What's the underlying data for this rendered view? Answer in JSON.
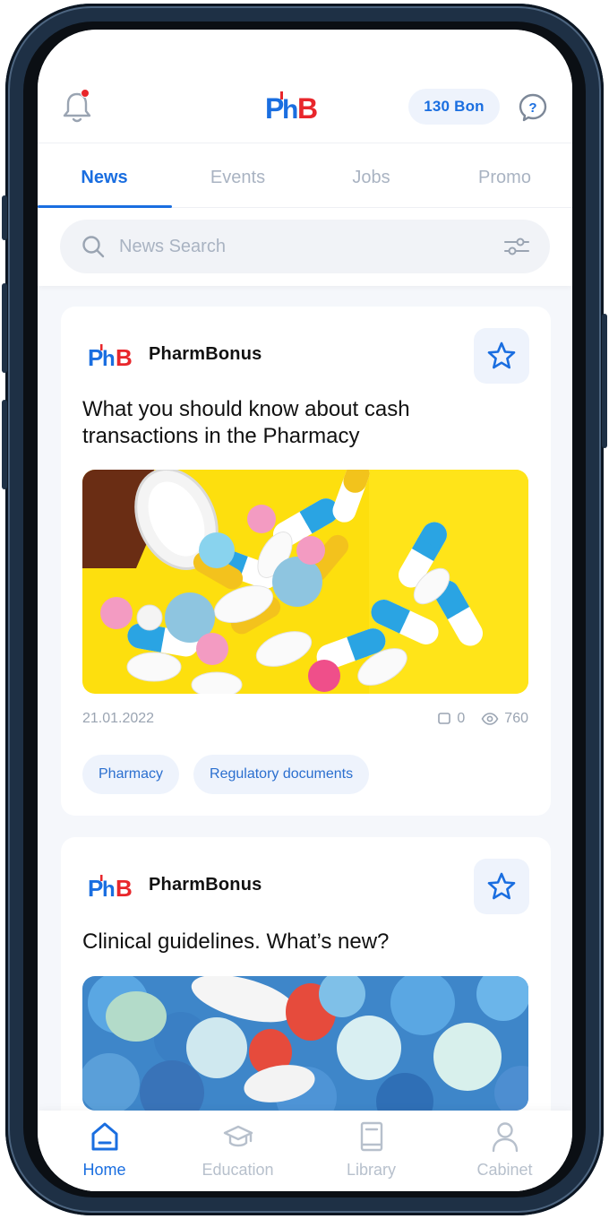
{
  "colors": {
    "accent": "#1a6ee0",
    "accent_bg": "#eef3fc",
    "notification_dot": "#e8262b",
    "inactive": "#a9b3c2",
    "logo_red": "#e8262b",
    "logo_blue": "#1a6ee0"
  },
  "header": {
    "logo_text": "PhB",
    "bonus_label": "130 Bon",
    "icons": {
      "left": "bell-icon",
      "right": "help-icon"
    }
  },
  "tabs": [
    {
      "label": "News",
      "active": true
    },
    {
      "label": "Events",
      "active": false
    },
    {
      "label": "Jobs",
      "active": false
    },
    {
      "label": "Promo",
      "active": false
    }
  ],
  "search": {
    "placeholder": "News Search",
    "value": "",
    "icon": "search-icon",
    "filter_icon": "filter-icon"
  },
  "posts": [
    {
      "source": "PharmBonus",
      "title": "What you should know about cash transactions in the Pharmacy",
      "date": "21.01.2022",
      "comments": "0",
      "views": "760",
      "tags": [
        "Pharmacy",
        "Regulatory documents"
      ]
    },
    {
      "source": "PharmBonus",
      "title": "Clinical guidelines. What’s new?"
    }
  ],
  "bottom_nav": [
    {
      "label": "Home",
      "icon": "home-icon",
      "active": true
    },
    {
      "label": "Education",
      "icon": "graduation-cap-icon",
      "active": false
    },
    {
      "label": "Library",
      "icon": "book-icon",
      "active": false
    },
    {
      "label": "Cabinet",
      "icon": "user-icon",
      "active": false
    }
  ]
}
